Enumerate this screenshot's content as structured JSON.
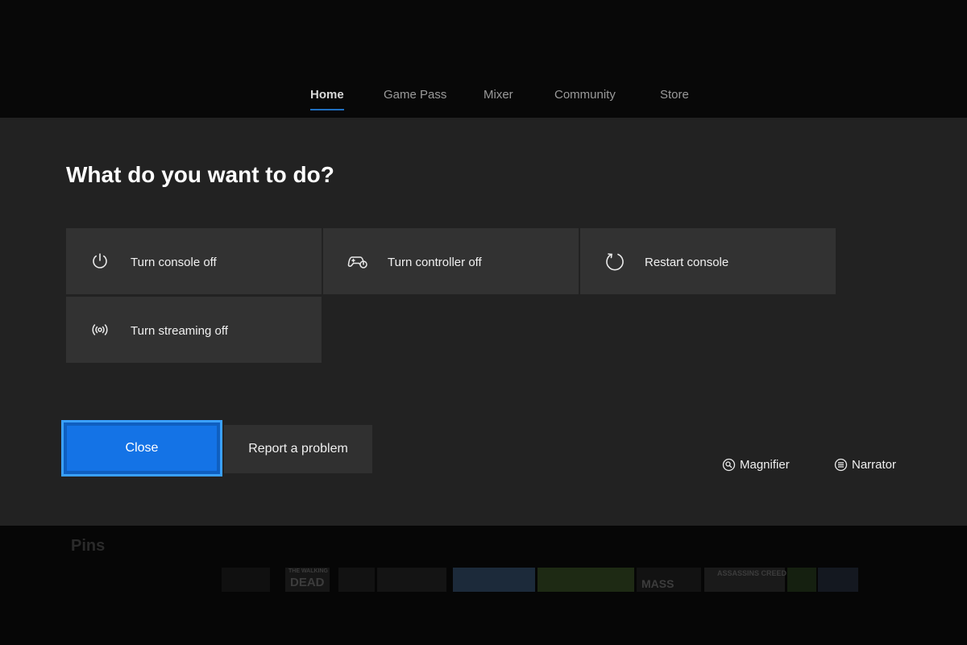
{
  "nav": {
    "tabs": [
      {
        "label": "Home",
        "active": true
      },
      {
        "label": "Game Pass",
        "active": false
      },
      {
        "label": "Mixer",
        "active": false
      },
      {
        "label": "Community",
        "active": false
      },
      {
        "label": "Store",
        "active": false
      }
    ]
  },
  "dialog": {
    "title": "What do you want to do?",
    "options": [
      {
        "label": "Turn console off",
        "icon": "power-icon"
      },
      {
        "label": "Turn controller off",
        "icon": "controller-power-icon"
      },
      {
        "label": "Restart console",
        "icon": "restart-icon"
      },
      {
        "label": "Turn streaming off",
        "icon": "streaming-icon"
      }
    ],
    "close_label": "Close",
    "report_label": "Report a problem",
    "magnifier_label": "Magnifier",
    "narrator_label": "Narrator"
  },
  "background": {
    "pins_label": "Pins",
    "tiles": [
      "THE WALKING",
      "DEAD",
      "MASS",
      "ASSASSINS CREED"
    ]
  },
  "colors": {
    "accent": "#1473e6",
    "focus": "#3aa0ff",
    "dialog_bg": "#222222",
    "option_bg": "#323232"
  }
}
